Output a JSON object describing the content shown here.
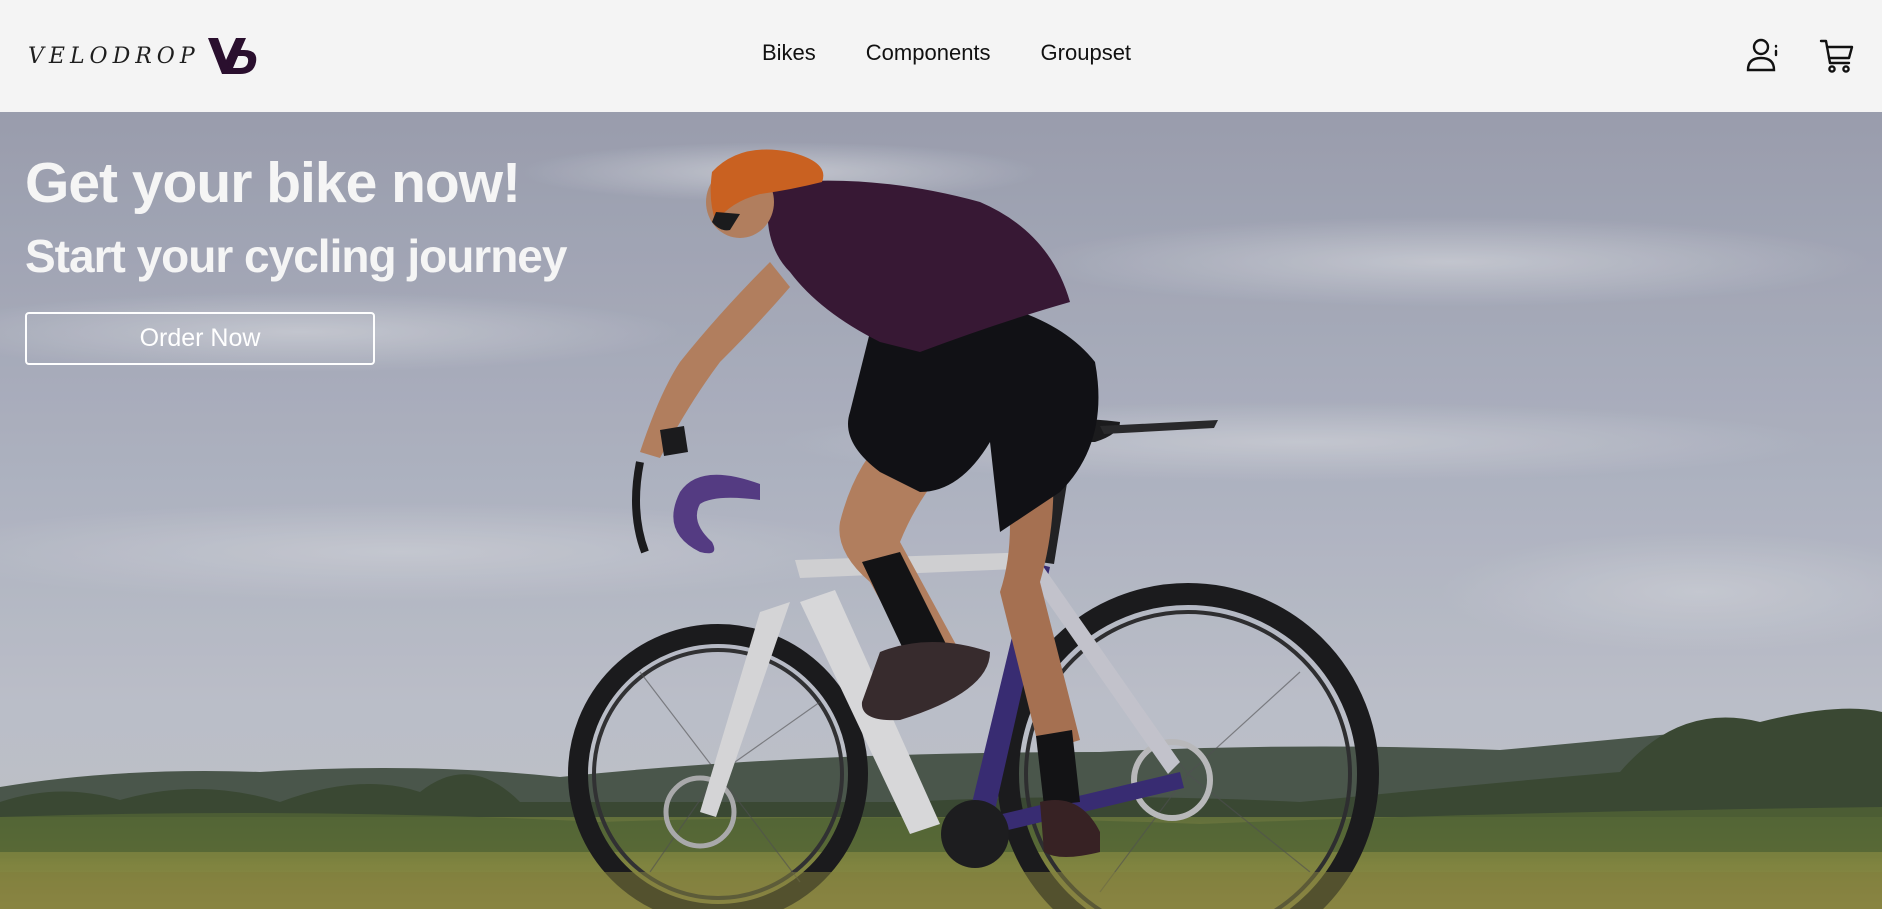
{
  "brand": {
    "logo_text": "VELODROP",
    "logo_color": "#2a0f2e"
  },
  "nav": {
    "items": [
      {
        "label": "Bikes"
      },
      {
        "label": "Components"
      },
      {
        "label": "Groupset"
      }
    ]
  },
  "header_icons": {
    "user": "user-icon",
    "cart": "cart-icon"
  },
  "hero": {
    "title": "Get your bike now!",
    "subtitle": "Start your cycling journey",
    "cta_label": "Order Now",
    "image": "road-cyclist-photo"
  },
  "colors": {
    "header_bg": "#f4f4f4",
    "hero_text": "#f5f5f5",
    "jersey": "#3a1634",
    "helmet": "#e0691e",
    "bar_tape": "#5a3e8c"
  }
}
